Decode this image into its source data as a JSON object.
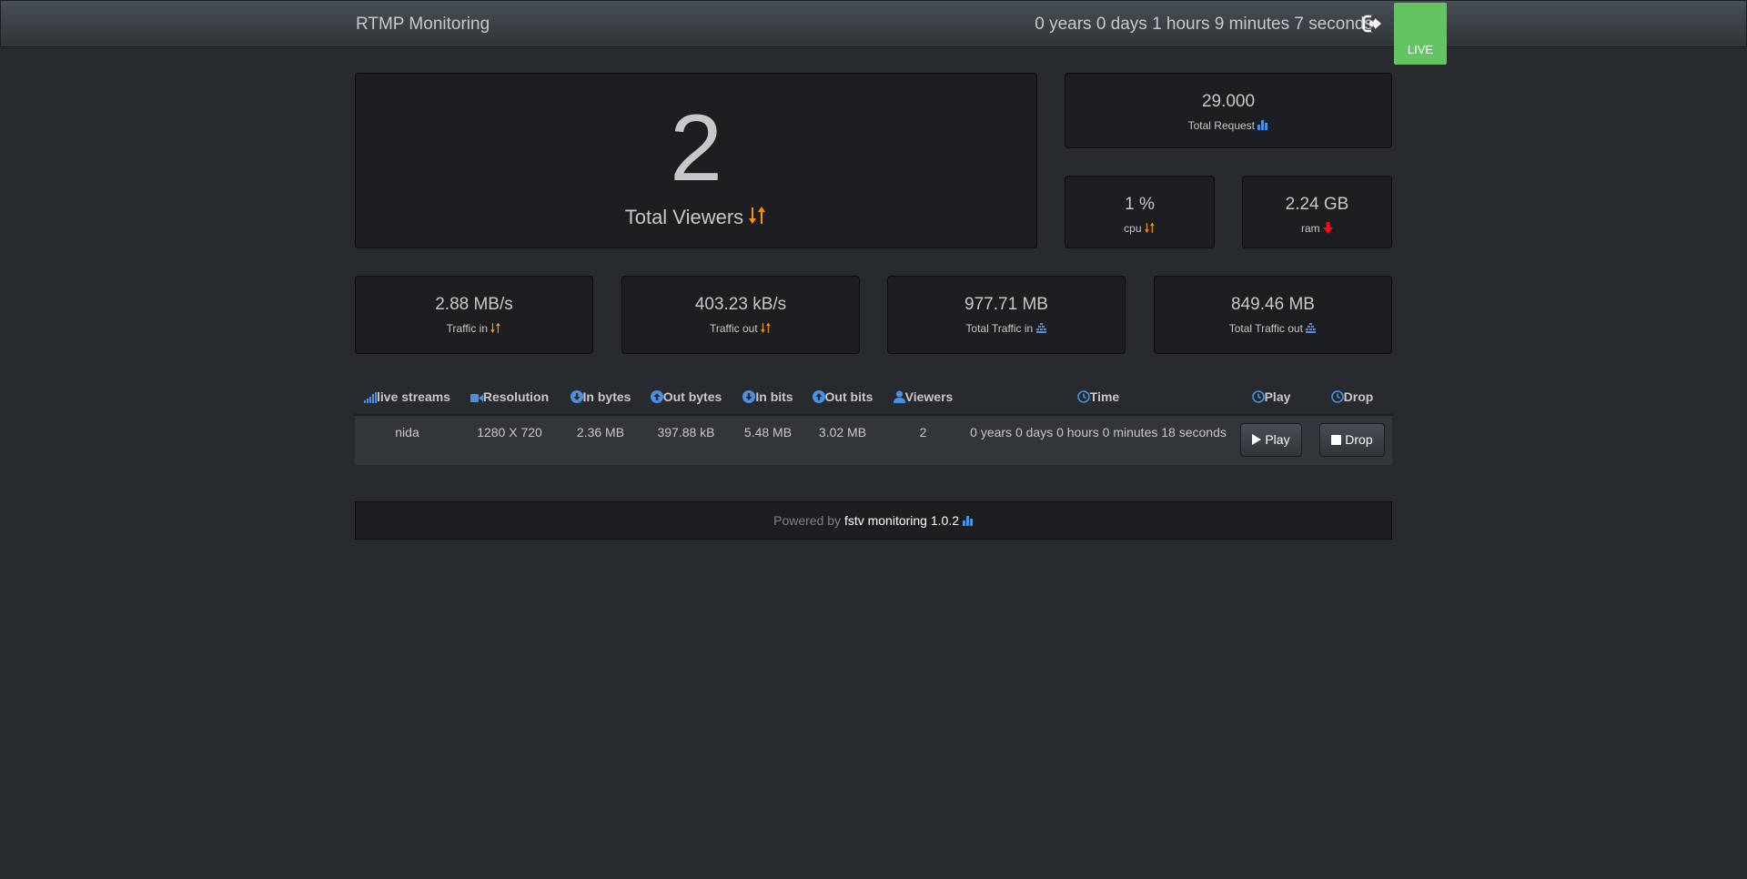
{
  "navbar": {
    "brand": "RTMP Monitoring",
    "uptime": "0 years 0 days 1 hours 9 minutes 7 seconds",
    "live_label": "LIVE"
  },
  "stats": {
    "total_viewers": {
      "value": "2",
      "label": "Total Viewers"
    },
    "total_request": {
      "value": "29.000",
      "label": "Total Request"
    },
    "cpu": {
      "value": "1 %",
      "label": "cpu"
    },
    "ram": {
      "value": "2.24 GB",
      "label": "ram"
    },
    "traffic_in": {
      "value": "2.88 MB/s",
      "label": "Traffic in"
    },
    "traffic_out": {
      "value": "403.23 kB/s",
      "label": "Traffic out"
    },
    "total_traffic_in": {
      "value": "977.71 MB",
      "label": "Total Traffic in"
    },
    "total_traffic_out": {
      "value": "849.46 MB",
      "label": "Total Traffic out"
    }
  },
  "table": {
    "headers": [
      "live streams",
      "Resolution",
      "In bytes",
      "Out bytes",
      "In bits",
      "Out bits",
      "Viewers",
      "Time",
      "Play",
      "Drop"
    ],
    "rows": [
      {
        "name": "nida",
        "resolution": "1280 X 720",
        "in_bytes": "2.36 MB",
        "out_bytes": "397.88 kB",
        "in_bits": "5.48 MB",
        "out_bits": "3.02 MB",
        "viewers": "2",
        "time": "0 years 0 days 0 hours 0 minutes 18 seconds",
        "play_label": "Play",
        "drop_label": "Drop"
      }
    ]
  },
  "footer": {
    "prefix": "Powered by",
    "link": "fstv monitoring 1.0.2"
  },
  "colors": {
    "background": "#272b30",
    "panel": "#1c1e22",
    "accent_orange": "#f89406",
    "accent_blue": "#5bc0de",
    "icon_blue": "#4a90e2",
    "danger_red": "#ee1111",
    "live_green": "#62c462"
  }
}
